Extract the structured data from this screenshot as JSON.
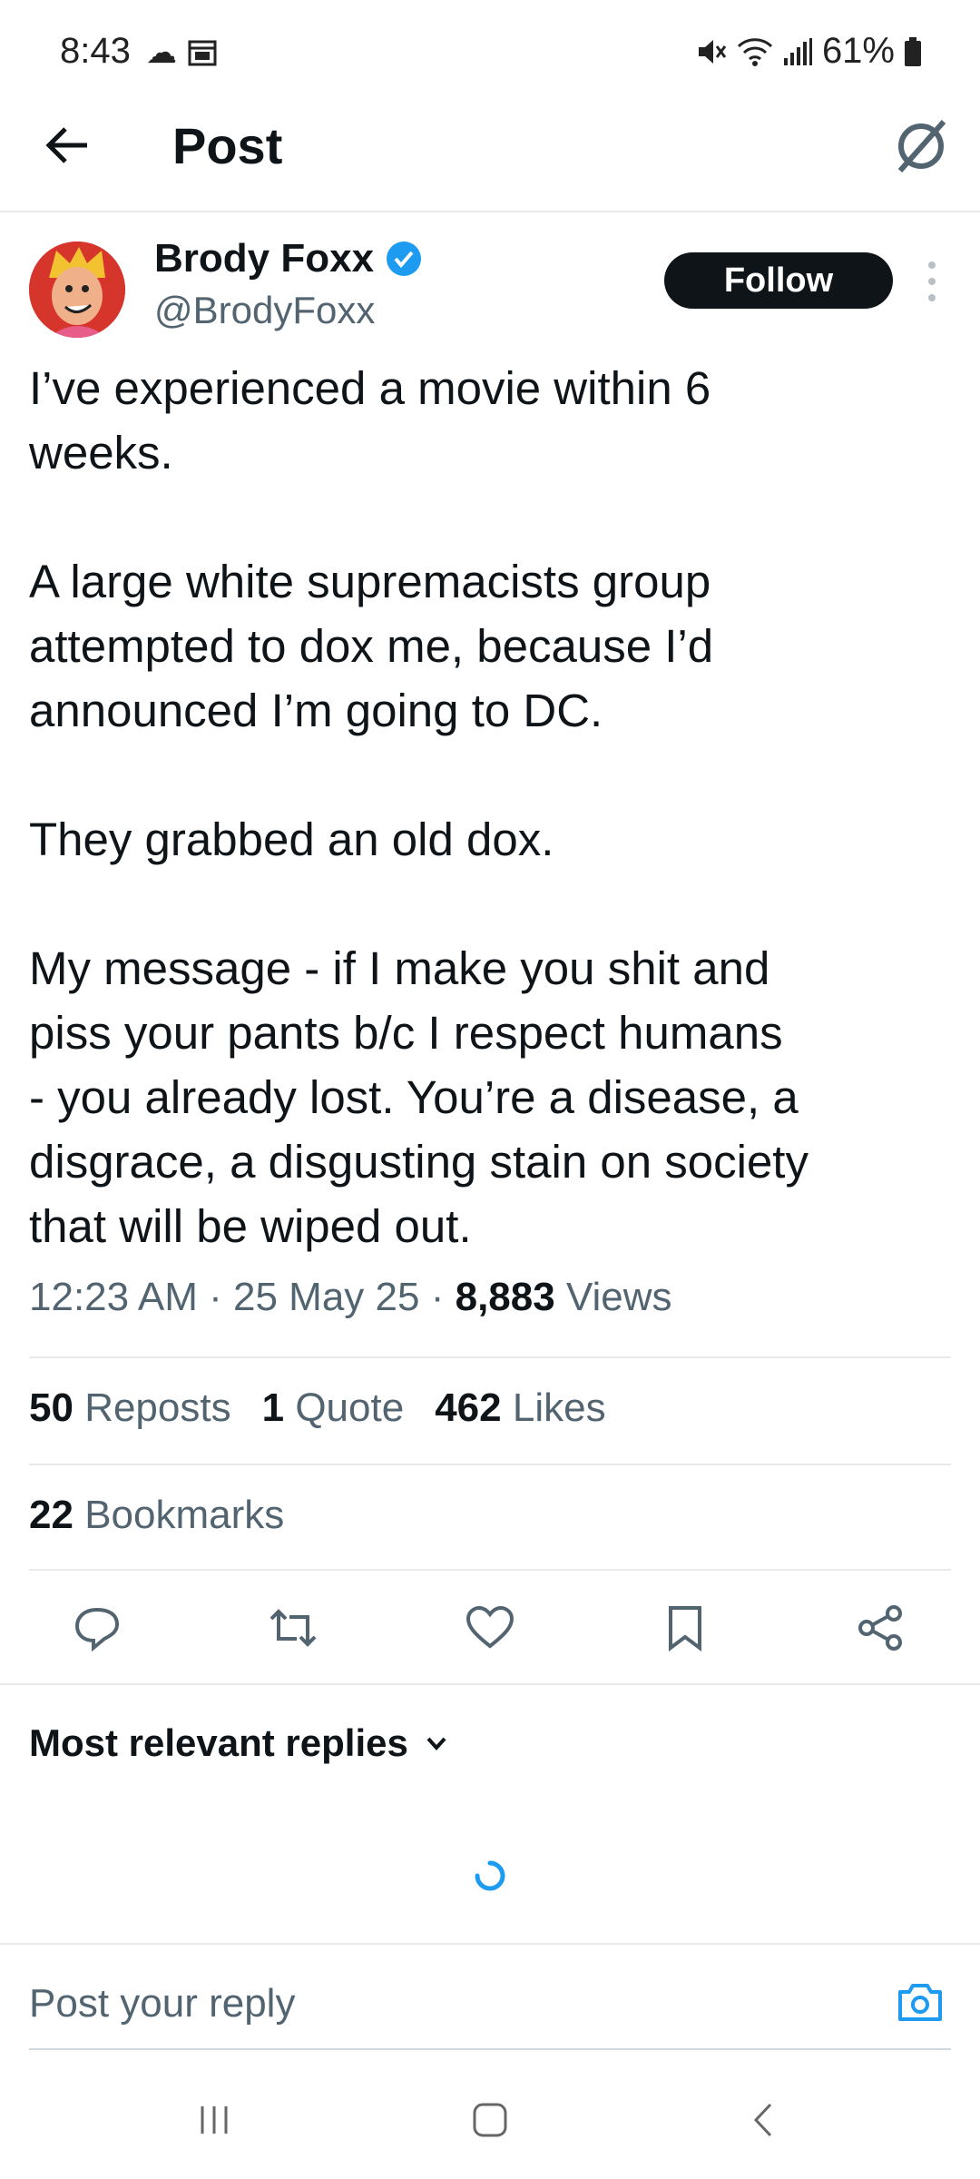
{
  "status_bar": {
    "time": "8:43",
    "battery": "61%",
    "icons": [
      "cloud-icon",
      "calendar-icon",
      "mute-icon",
      "wifi-icon",
      "signal-icon",
      "battery-icon"
    ]
  },
  "header": {
    "title": "Post",
    "back_icon": "back-arrow-icon",
    "right_icon": "grok-icon"
  },
  "post": {
    "author_name": "Brody Foxx",
    "author_handle": "@BrodyFoxx",
    "verified": true,
    "follow_label": "Follow",
    "text": "I’ve experienced a movie within 6\nweeks.\n\nA large white supremacists group\nattempted to dox me, because I’d\nannounced I’m going to DC.\n\nThey grabbed an old dox.\n\nMy message - if I make you shit and\npiss your pants b/c I respect humans\n- you already lost. You’re a disease, a\ndisgrace, a disgusting stain on society\nthat will be wiped out.",
    "time": "12:23 AM",
    "date": "25 May 25",
    "views_count": "8,883",
    "views_label": "Views",
    "reposts_count": "50",
    "reposts_label": "Reposts",
    "quotes_count": "1",
    "quotes_label": "Quote",
    "likes_count": "462",
    "likes_label": "Likes",
    "bookmarks_count": "22",
    "bookmarks_label": "Bookmarks"
  },
  "actions": [
    "reply-icon",
    "repost-icon",
    "like-icon",
    "bookmark-icon",
    "share-icon"
  ],
  "replies": {
    "sort_label": "Most relevant replies"
  },
  "reply_box": {
    "placeholder": "Post your reply"
  },
  "colors": {
    "accent": "#1d9bf0",
    "text": "#0f1419",
    "secondary": "#536471",
    "divider": "#e7e9ea"
  }
}
